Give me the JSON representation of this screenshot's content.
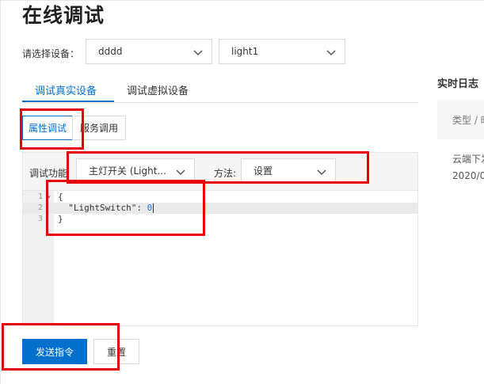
{
  "page": {
    "title": "在线调试"
  },
  "device_selector": {
    "label": "请选择设备：",
    "product_value": "dddd",
    "device_value": "light1"
  },
  "tabs": [
    {
      "label": "调试真实设备",
      "active": true
    },
    {
      "label": "调试虚拟设备",
      "active": false
    }
  ],
  "sub_tabs": [
    {
      "label": "属性调试",
      "active": true
    },
    {
      "label": "服务调用",
      "active": false
    }
  ],
  "debug": {
    "function_label": "调试功能",
    "function_value": "主灯开关 (Light...",
    "method_label": "方法:",
    "method_value": "设置"
  },
  "editor": {
    "line_numbers": [
      "1",
      "2",
      "3"
    ],
    "line1": "{",
    "line2_key": "\"LightSwitch\"",
    "line2_sep": ": ",
    "line2_value": "0",
    "line3": "}"
  },
  "buttons": {
    "send": "发送指令",
    "reset": "重置"
  },
  "log": {
    "title": "实时日志",
    "col_type": "类型 / 时",
    "row_event": "云端下发",
    "row_date": "2020/0"
  },
  "colors": {
    "accent": "#0070cc",
    "highlight": "#e8000b"
  }
}
